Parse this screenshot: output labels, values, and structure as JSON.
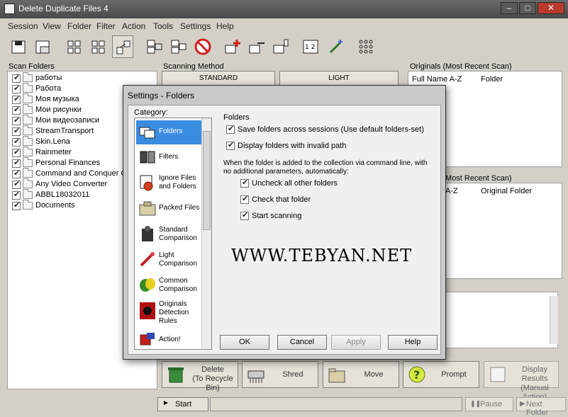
{
  "window": {
    "title": "Delete Duplicate Files 4",
    "min": "–",
    "max": "□",
    "close": "✕"
  },
  "menu": [
    "Session",
    "View",
    "Folder",
    "Filter",
    "Action",
    "Tools",
    "Settings",
    "Help"
  ],
  "toolbar": {
    "icons": [
      "save-session-icon",
      "load-session-icon",
      "view-grid-icon",
      "view-tiles-icon",
      "view-tiles-alt-icon",
      "view-tree-icon",
      "compare-icon",
      "compare-alt-icon",
      "no-filter-icon",
      "add-folder-icon",
      "remove-folder-icon",
      "folder-down-icon",
      "numbers-icon",
      "magic-wand-icon",
      "dots-grid-icon"
    ]
  },
  "scan_folders": {
    "label": "Scan Folders",
    "items": [
      {
        "name": "работы",
        "checked": true
      },
      {
        "name": "Работа",
        "checked": true
      },
      {
        "name": "Моя музыка",
        "checked": true
      },
      {
        "name": "Мои рисунки",
        "checked": true
      },
      {
        "name": "Мои видеозаписи",
        "checked": true
      },
      {
        "name": "StreamTransport",
        "checked": true
      },
      {
        "name": "Skin.Lena",
        "checked": true
      },
      {
        "name": "Rainmeter",
        "checked": true
      },
      {
        "name": "Personal Finances",
        "checked": true
      },
      {
        "name": "Command and Conquer  Gene",
        "checked": true
      },
      {
        "name": "Any Video Converter",
        "checked": true
      },
      {
        "name": "ABBL18032011",
        "checked": true
      },
      {
        "name": "Documents",
        "checked": true
      }
    ]
  },
  "scanning_method": {
    "label": "Scanning Method",
    "standard": "STANDARD",
    "light": "LIGHT"
  },
  "originals": {
    "label": "Originals (Most Recent Scan)",
    "col1": "Full Name A-Z",
    "col2": "Folder"
  },
  "duplicates": {
    "label": "Most Recent Scan)",
    "col1": "A-Z",
    "col2": "Original Folder"
  },
  "actions": {
    "delete": "Delete\n(To Recycle Bin)",
    "shred": "Shred",
    "move": "Move",
    "prompt": "Prompt",
    "display": "Display Results\n(Manual Action)"
  },
  "bottom": {
    "start": "Start",
    "pause": "Pause",
    "next_folder": "Next Folder"
  },
  "dialog": {
    "title": "Settings - Folders",
    "category_label": "Category:",
    "categories": [
      {
        "label": "Folders",
        "icon": "folders-icon"
      },
      {
        "label": "Filters",
        "icon": "filters-icon"
      },
      {
        "label": "Ignore Files and Folders",
        "icon": "ignore-icon"
      },
      {
        "label": "Packed Files",
        "icon": "packed-files-icon"
      },
      {
        "label": "Standard Comparison",
        "icon": "standard-comparison-icon"
      },
      {
        "label": "Light Comparison",
        "icon": "light-comparison-icon"
      },
      {
        "label": "Common Comparison",
        "icon": "common-comparison-icon"
      },
      {
        "label": "Originals Detection Rules",
        "icon": "originals-rules-icon"
      },
      {
        "label": "Action!",
        "icon": "action-icon"
      }
    ],
    "section": "Folders",
    "opt_save": "Save folders across sessions (Use default folders-set)",
    "opt_invalid": "Display folders with invalid path",
    "cmdline_text": "When the folder is added to the collection via command line, with no additional parameters, automatically:",
    "opt_uncheck": "Uncheck all other folders",
    "opt_check": "Check that folder",
    "opt_start": "Start scanning",
    "watermark": "WWW.TEBYAN.NET",
    "ok": "OK",
    "cancel": "Cancel",
    "apply": "Apply",
    "help": "Help"
  }
}
